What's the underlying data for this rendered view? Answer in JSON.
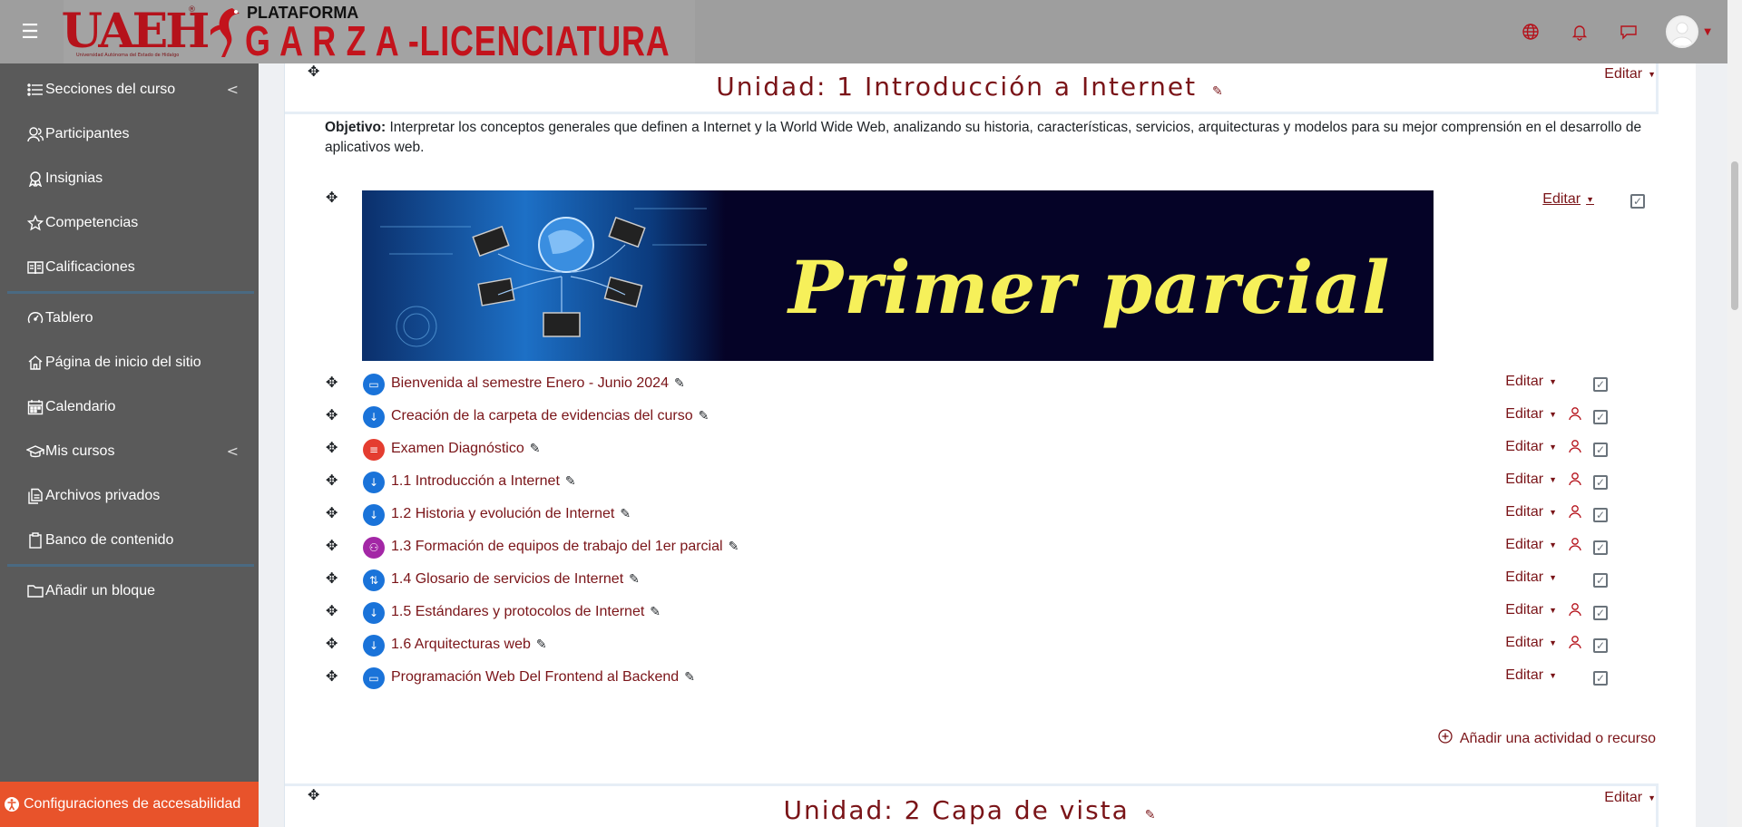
{
  "navbar": {
    "logo_text": "UAEH",
    "logo_sub": "Universidad Autónoma del Estado de Hidalgo",
    "brand_top": "PLATAFORMA",
    "brand_main": "G A R Z A -LICENCIATURA",
    "icons": [
      "globe-icon",
      "bell-icon",
      "chat-icon",
      "avatar",
      "caret-down-icon"
    ]
  },
  "sidebar": {
    "items": [
      {
        "label": "Secciones del curso",
        "icon": "list-icon",
        "chevron": "<"
      },
      {
        "label": "Participantes",
        "icon": "users-icon"
      },
      {
        "label": "Insignias",
        "icon": "badge-icon"
      },
      {
        "label": "Competencias",
        "icon": "star-icon"
      },
      {
        "label": "Calificaciones",
        "icon": "gradebook-icon"
      },
      {
        "label": "Tablero",
        "icon": "dashboard-icon"
      },
      {
        "label": "Página de inicio del sitio",
        "icon": "home-icon"
      },
      {
        "label": "Calendario",
        "icon": "calendar-icon"
      },
      {
        "label": "Mis cursos",
        "icon": "graduation-cap-icon",
        "chevron": "<"
      },
      {
        "label": "Archivos privados",
        "icon": "files-icon"
      },
      {
        "label": "Banco de contenido",
        "icon": "clipboard-icon"
      },
      {
        "label": "Añadir un bloque",
        "icon": "folder-icon"
      }
    ],
    "accessibility": "Configuraciones de accesabilidad"
  },
  "section1": {
    "title": "Unidad: 1 Introducción a Internet",
    "edit_label": "Editar",
    "objective_label": "Objetivo:",
    "objective_text": " Interpretar los conceptos generales que definen a Internet y la World Wide Web, analizando su historia, características, servicios, arquitecturas y modelos para su mejor comprensión en el desarrollo de aplicativos web.",
    "banner_text": "Primer parcial",
    "banner_edit": "Editar",
    "activities": [
      {
        "name": "Bienvenida al semestre Enero - Junio 2024",
        "type": "page",
        "color": "#1a73d9",
        "restricted": false
      },
      {
        "name": "Creación de la carpeta de evidencias del curso",
        "type": "assignment",
        "color": "#1a73d9",
        "restricted": true
      },
      {
        "name": "Examen Diagnóstico",
        "type": "quiz",
        "color": "#e43d30",
        "restricted": true
      },
      {
        "name": "1.1 Introducción a Internet",
        "type": "assignment",
        "color": "#1a73d9",
        "restricted": true
      },
      {
        "name": "1.2 Historia y evolución de Internet",
        "type": "assignment",
        "color": "#1a73d9",
        "restricted": true
      },
      {
        "name": "1.3 Formación de equipos de trabajo del 1er parcial",
        "type": "group",
        "color": "#a327a6",
        "restricted": true
      },
      {
        "name": "1.4 Glosario de servicios de Internet",
        "type": "glossary",
        "color": "#1a73d9",
        "restricted": false
      },
      {
        "name": "1.5 Estándares y protocolos de Internet",
        "type": "assignment",
        "color": "#1a73d9",
        "restricted": true
      },
      {
        "name": "1.6 Arquitecturas web",
        "type": "assignment",
        "color": "#1a73d9",
        "restricted": true
      },
      {
        "name": "Programación Web Del Frontend al Backend",
        "type": "page",
        "color": "#1a73d9",
        "restricted": false
      }
    ],
    "activity_edit": "Editar",
    "add_activity": "Añadir una actividad o recurso"
  },
  "section2": {
    "title": "Unidad: 2 Capa de vista",
    "edit_label": "Editar"
  }
}
